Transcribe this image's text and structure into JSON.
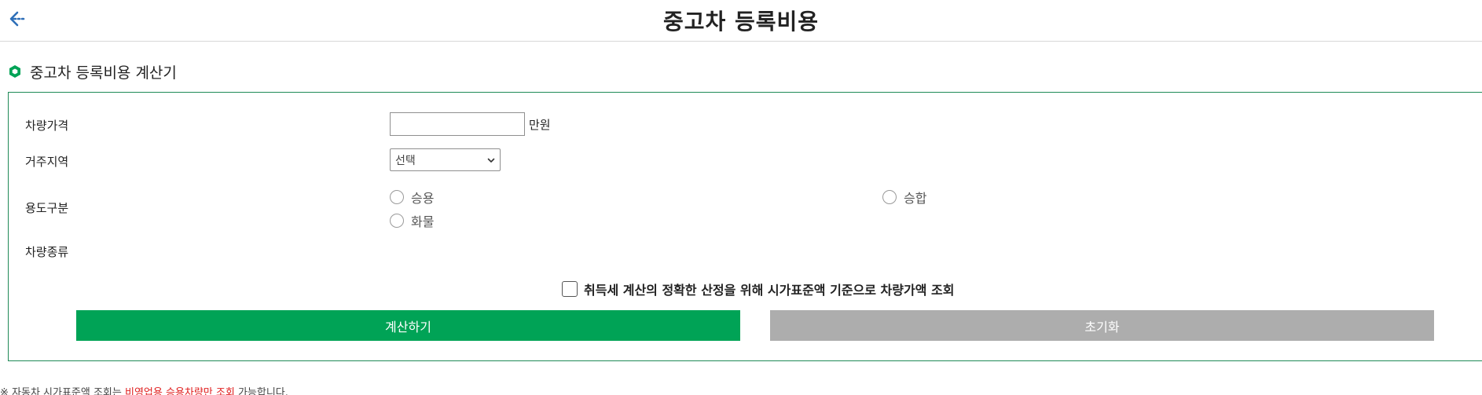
{
  "header": {
    "title": "중고차 등록비용",
    "back_icon": "arrow-left-icon",
    "accent": "#2e6fb8"
  },
  "section": {
    "title": "중고차 등록비용 계산기",
    "icon": "hexagon-icon",
    "accent": "#00a356"
  },
  "form": {
    "price": {
      "label": "차량가격",
      "value": "",
      "placeholder": "",
      "unit": "만원"
    },
    "region": {
      "label": "거주지역",
      "selected": "선택"
    },
    "usage": {
      "label": "용도구분",
      "options": [
        {
          "label": "승용",
          "checked": false
        },
        {
          "label": "승합",
          "checked": false
        },
        {
          "label": "화물",
          "checked": false
        }
      ]
    },
    "vehicle_type": {
      "label": "차량종류"
    },
    "lookup": {
      "label": "취득세 계산의 정확한 산정을 위해 시가표준액 기준으로 차량가액 조회",
      "checked": false
    }
  },
  "buttons": {
    "calculate": "계산하기",
    "reset": "초기화",
    "calculate_color": "#00a356",
    "reset_color": "#adadad"
  },
  "footnote": {
    "prefix": "※ 자동차 시가표준액 조회는 ",
    "highlight": "비영업용 승용차량만 조회",
    "suffix": " 가능합니다.",
    "highlight_color": "#e01e1e"
  }
}
